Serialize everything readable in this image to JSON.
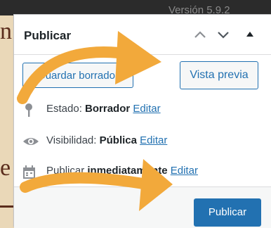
{
  "background": {
    "version_text": "Versión 5.9.2",
    "left_letters": [
      "n",
      "e"
    ]
  },
  "panel": {
    "title": "Publicar",
    "header_icons": [
      "chevron-up-icon",
      "chevron-down-icon",
      "triangle-up-icon"
    ],
    "save_draft_label": "Guardar borrador",
    "preview_label": "Vista previa",
    "status": {
      "label": "Estado:",
      "value": "Borrador",
      "edit": "Editar"
    },
    "visibility": {
      "label": "Visibilidad:",
      "value": "Pública",
      "edit": "Editar"
    },
    "schedule": {
      "label": "Publicar",
      "value": "inmediatamente",
      "edit": "Editar"
    },
    "publish_label": "Publicar"
  },
  "colors": {
    "accent": "#2271b1",
    "arrow": "#f2a93b",
    "background": "#ead8b8"
  }
}
